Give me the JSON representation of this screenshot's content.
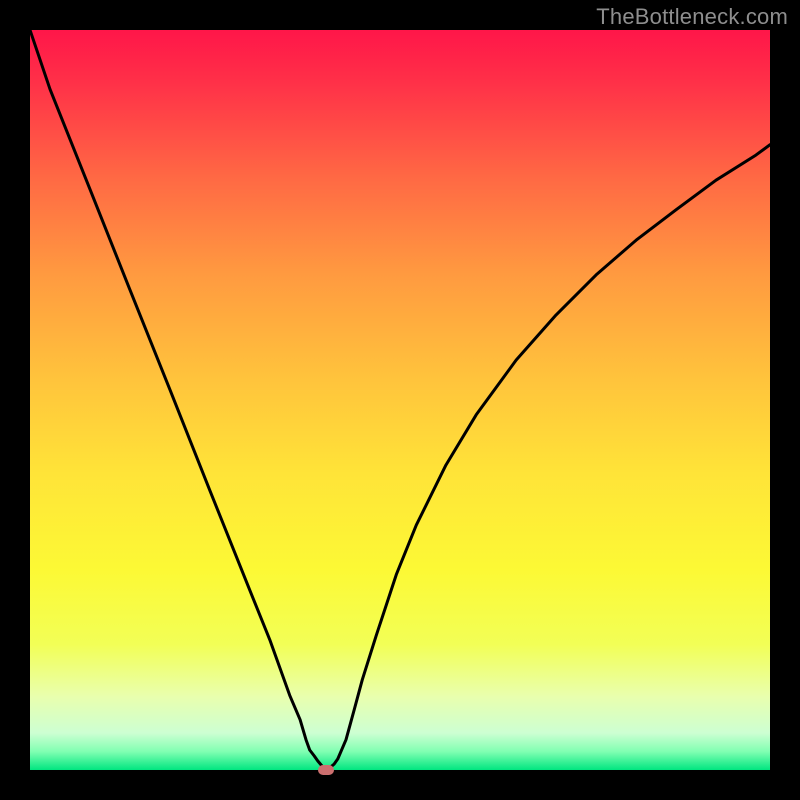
{
  "watermark": {
    "text": "TheBottleneck.com"
  },
  "chart_data": {
    "type": "line",
    "title": "",
    "xlabel": "",
    "ylabel": "",
    "xlim": [
      0,
      100
    ],
    "ylim": [
      0,
      100
    ],
    "grid": false,
    "legend": false,
    "background_gradient_stops": [
      {
        "pos": 0.0,
        "color": "#ff1649"
      },
      {
        "pos": 0.07,
        "color": "#ff3048"
      },
      {
        "pos": 0.2,
        "color": "#ff6944"
      },
      {
        "pos": 0.33,
        "color": "#ff9a40"
      },
      {
        "pos": 0.47,
        "color": "#ffc33c"
      },
      {
        "pos": 0.6,
        "color": "#ffe438"
      },
      {
        "pos": 0.73,
        "color": "#fcf935"
      },
      {
        "pos": 0.83,
        "color": "#f2ff56"
      },
      {
        "pos": 0.9,
        "color": "#e9ffad"
      },
      {
        "pos": 0.95,
        "color": "#cdffd2"
      },
      {
        "pos": 0.975,
        "color": "#81ffb2"
      },
      {
        "pos": 1.0,
        "color": "#00e680"
      }
    ],
    "series": [
      {
        "name": "bottleneck-curve",
        "note": "V-shaped curve; minimum at x≈40, y≈0. Values estimated from pixel readout.",
        "x": [
          0.0,
          2.7,
          8.1,
          13.5,
          18.9,
          24.3,
          29.7,
          32.4,
          35.1,
          36.5,
          37.3,
          37.8,
          38.4,
          38.9,
          39.5,
          40.0,
          40.5,
          41.1,
          41.6,
          42.7,
          43.8,
          44.9,
          46.8,
          49.5,
          52.2,
          56.2,
          60.3,
          65.7,
          71.1,
          76.5,
          81.9,
          87.3,
          92.7,
          98.1,
          100.0
        ],
        "y": [
          100.0,
          92.0,
          78.5,
          64.9,
          51.4,
          37.8,
          24.3,
          17.6,
          10.1,
          6.8,
          4.1,
          2.7,
          1.9,
          1.2,
          0.5,
          0.0,
          0.3,
          0.8,
          1.5,
          4.1,
          8.1,
          12.2,
          18.2,
          26.4,
          33.1,
          41.2,
          48.0,
          55.4,
          61.5,
          66.9,
          71.6,
          75.7,
          79.7,
          83.1,
          84.5
        ]
      }
    ],
    "marker": {
      "x": 40.0,
      "y": 0.0,
      "color": "#cc6f6f",
      "shape": "pill"
    }
  }
}
